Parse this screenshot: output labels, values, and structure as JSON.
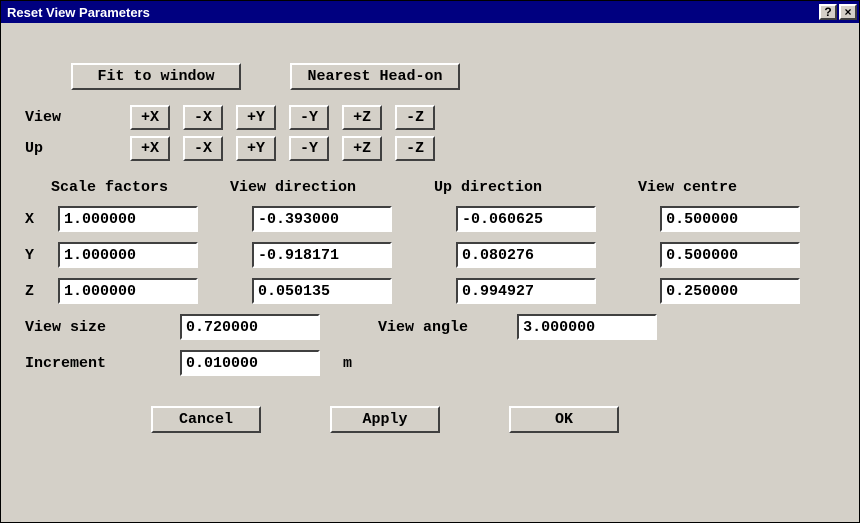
{
  "window": {
    "title": "Reset View Parameters",
    "help": "?",
    "close": "×"
  },
  "top": {
    "fit": "Fit to window",
    "nearest": "Nearest Head-on"
  },
  "axis": {
    "view_label": "View",
    "up_label": "Up",
    "px": "+X",
    "nx": "-X",
    "py": "+Y",
    "ny": "-Y",
    "pz": "+Z",
    "nz": "-Z"
  },
  "headers": {
    "scale": "Scale factors",
    "viewdir": "View direction",
    "updir": "Up direction",
    "centre": "View centre"
  },
  "rows": {
    "x_label": "X",
    "y_label": "Y",
    "z_label": "Z"
  },
  "scale": {
    "x": "1.000000",
    "y": "1.000000",
    "z": "1.000000"
  },
  "viewdir": {
    "x": "-0.393000",
    "y": "-0.918171",
    "z": "0.050135"
  },
  "updir": {
    "x": "-0.060625",
    "y": "0.080276",
    "z": "0.994927"
  },
  "centre": {
    "x": "0.500000",
    "y": "0.500000",
    "z": "0.250000"
  },
  "viewsize": {
    "label": "View size",
    "value": "0.720000"
  },
  "viewangle": {
    "label": "View angle",
    "value": "3.000000"
  },
  "increment": {
    "label": "Increment",
    "value": "0.010000",
    "unit": "m"
  },
  "actions": {
    "cancel": "Cancel",
    "apply": "Apply",
    "ok": "OK"
  }
}
